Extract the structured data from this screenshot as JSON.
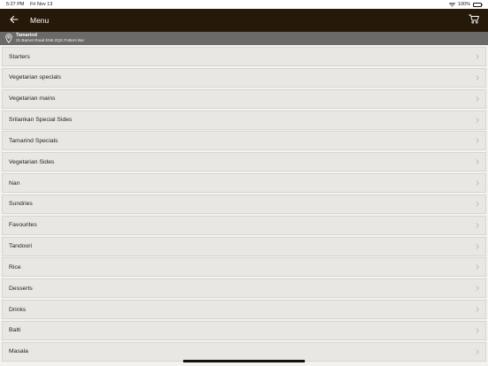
{
  "status": {
    "time": "5:27 PM",
    "date": "Fri Nov 13",
    "battery": "100%"
  },
  "nav": {
    "title": "Menu"
  },
  "location": {
    "name": "Tamarind",
    "address": "21 Barnet Road EN6 2QX Potters Bar"
  },
  "menu": {
    "items": [
      {
        "label": "Starters"
      },
      {
        "label": "Vegetarian specials"
      },
      {
        "label": "Vegetarian mains"
      },
      {
        "label": "Srilankan Special Sides"
      },
      {
        "label": "Tamarind Specials"
      },
      {
        "label": "Vegetarian Sides"
      },
      {
        "label": "Nan"
      },
      {
        "label": "Sundries"
      },
      {
        "label": "Favourites"
      },
      {
        "label": "Tandoori"
      },
      {
        "label": "Rice"
      },
      {
        "label": "Desserts"
      },
      {
        "label": "Drinks"
      },
      {
        "label": "Balti"
      },
      {
        "label": "Masala"
      }
    ]
  },
  "colors": {
    "navbar": "#261909",
    "location_bar": "#6b6a68",
    "item_bg": "#e9e7e3"
  }
}
